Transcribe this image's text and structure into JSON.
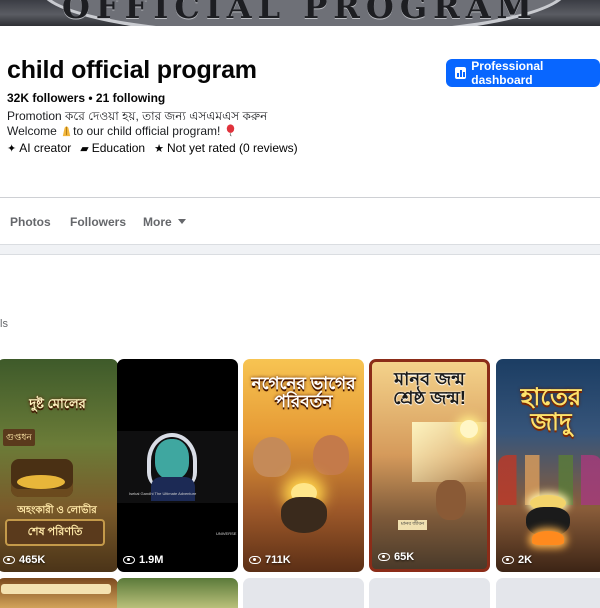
{
  "cover": {
    "text": "OFFICIAL PROGRAM"
  },
  "profile": {
    "name": "child official program",
    "stats": "32K followers • 21 following",
    "bio_line1": "Promotion করে দেওয়া হয়, তার জন্য এসএমএস করুন",
    "bio_line2_a": "Welcome ",
    "bio_line2_b": "to our child official program!",
    "meta": [
      {
        "icon": "sparkle-icon",
        "label": "AI creator"
      },
      {
        "icon": "briefcase-icon",
        "label": "Education"
      },
      {
        "icon": "star-icon",
        "label": "Not yet rated (0 reviews)"
      }
    ],
    "pro_button": "Professional dashboard"
  },
  "tabs": [
    "Photos",
    "Followers",
    "More"
  ],
  "section_label": "ls",
  "reels": [
    {
      "title": "দুষ্ট মোলের",
      "subtitle": "অহংকারী ও লোভীর",
      "bottom": "শেষ পরিণতি",
      "sign": "গুপ্তধন",
      "views": "465K"
    },
    {
      "title": "",
      "caption": "Isekai Gandhi The Ultimate Adventure",
      "logo": "UNIVERSE",
      "views": "1.9M"
    },
    {
      "title": "নগেনের ভাগের পরিবর্তন",
      "views": "711K"
    },
    {
      "title": "মানব জন্ম শ্রেষ্ঠ জন্ম!",
      "tag": "মানব জীবন",
      "views": "65K"
    },
    {
      "title": "হাতের জাদু",
      "views": "2K"
    }
  ],
  "colors": {
    "accent": "#0866ff",
    "muted": "#65676b",
    "divider": "#ced0d4"
  }
}
